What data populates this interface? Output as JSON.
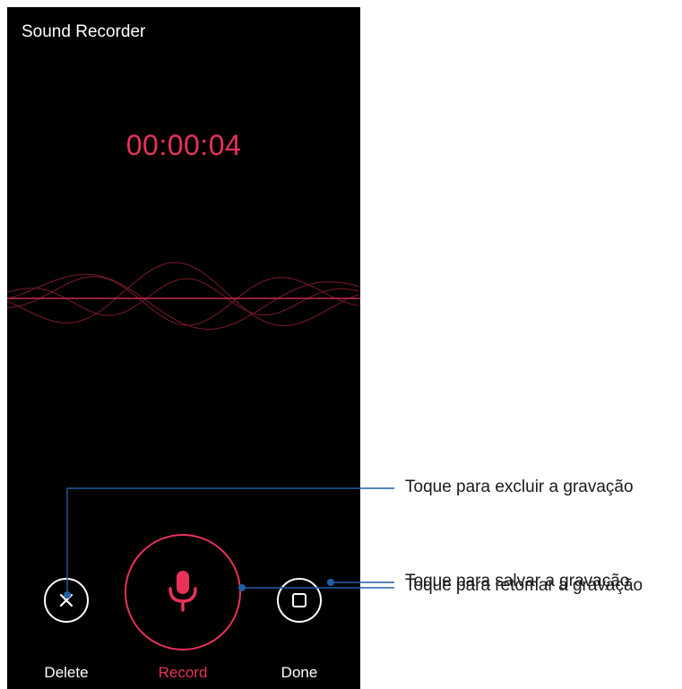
{
  "app": {
    "title": "Sound Recorder"
  },
  "recorder": {
    "elapsed_time": "00:00:04"
  },
  "controls": {
    "delete_label": "Delete",
    "record_label": "Record",
    "done_label": "Done",
    "delete_icon": "close-icon",
    "record_icon": "microphone-icon",
    "done_icon": "stop-square-icon"
  },
  "callouts": {
    "delete": "Toque para excluir a gravação",
    "record": "Toque para retomar a gravação",
    "done": "Toque para salvar a gravação",
    "line_color": "#1f5fa8"
  },
  "colors": {
    "background": "#000000",
    "accent": "#e8325a",
    "wave": "#7a1a2a",
    "text": "#ffffff"
  }
}
